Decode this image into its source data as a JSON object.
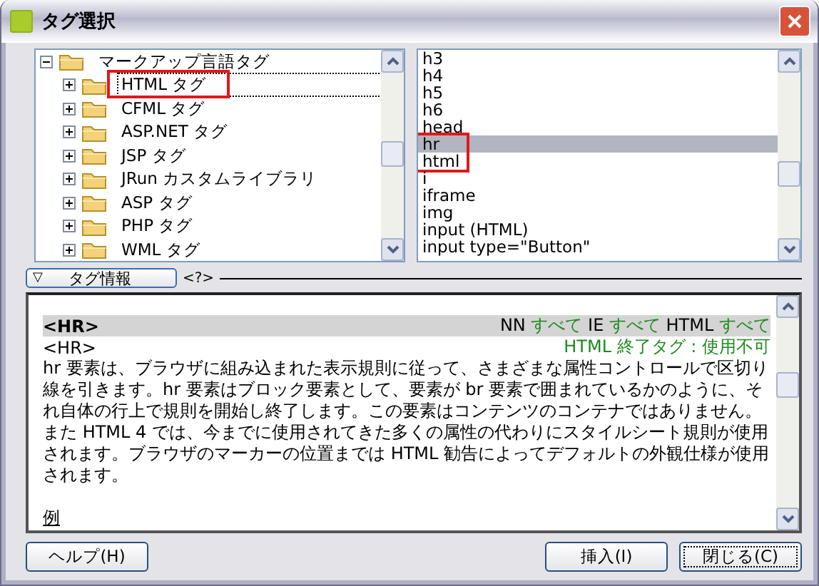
{
  "window": {
    "title": "タグ選択"
  },
  "tree": {
    "items": [
      {
        "label": "マークアップ言語タグ",
        "expanded": true,
        "focused": false,
        "highlighted": false,
        "children": [
          {
            "label": "HTML タグ",
            "expanded": false,
            "focused": true,
            "highlighted": true
          },
          {
            "label": "CFML タグ",
            "expanded": false,
            "focused": false,
            "highlighted": false
          },
          {
            "label": "ASP.NET タグ",
            "expanded": false,
            "focused": false,
            "highlighted": false
          },
          {
            "label": "JSP タグ",
            "expanded": false,
            "focused": false,
            "highlighted": false
          },
          {
            "label": "JRun カスタムライブラリ",
            "expanded": false,
            "focused": false,
            "highlighted": false
          },
          {
            "label": "ASP タグ",
            "expanded": false,
            "focused": false,
            "highlighted": false
          },
          {
            "label": "PHP タグ",
            "expanded": false,
            "focused": false,
            "highlighted": false
          },
          {
            "label": "WML タグ",
            "expanded": false,
            "focused": false,
            "highlighted": false
          }
        ]
      }
    ]
  },
  "tag_list": {
    "items": [
      {
        "label": "h3",
        "selected": false,
        "highlighted": false
      },
      {
        "label": "h4",
        "selected": false,
        "highlighted": false
      },
      {
        "label": "h5",
        "selected": false,
        "highlighted": false
      },
      {
        "label": "h6",
        "selected": false,
        "highlighted": false
      },
      {
        "label": "head",
        "selected": false,
        "highlighted": false
      },
      {
        "label": "hr",
        "selected": true,
        "highlighted": true
      },
      {
        "label": "html",
        "selected": false,
        "highlighted": true
      },
      {
        "label": "i",
        "selected": false,
        "highlighted": false
      },
      {
        "label": "iframe",
        "selected": false,
        "highlighted": false
      },
      {
        "label": "img",
        "selected": false,
        "highlighted": false
      },
      {
        "label": "input (HTML)",
        "selected": false,
        "highlighted": false
      },
      {
        "label": "input type=\"Button\"",
        "selected": false,
        "highlighted": false
      }
    ]
  },
  "section": {
    "toggle": "▽",
    "title": "タグ情報",
    "icon_text": "<?>"
  },
  "info": {
    "heading": "<HR>",
    "support": [
      {
        "label": "NN",
        "value": "すべて"
      },
      {
        "label": "IE",
        "value": "すべて"
      },
      {
        "label": "HTML",
        "value": "すべて"
      }
    ],
    "tag": "<HR>",
    "end_tag": "HTML 終了タグ : 使用不可",
    "description": "hr 要素は、ブラウザに組み込まれた表示規則に従って、さまざまな属性コントロールで区切り線を引きます。hr 要素はブロック要素として、要素が br 要素で囲まれているかのように、それ自体の行上で規則を開始し終了します。この要素はコンテンツのコンテナではありません。また HTML 4 では、今までに使用されてきた多くの属性の代わりにスタイルシート規則が使用されます。ブラウザのマーカーの位置までは HTML 勧告によってデフォルトの外観仕様が使用されます。",
    "example_link": "例"
  },
  "buttons": [
    {
      "label": "ヘルプ(H)",
      "kind": "help",
      "default": false
    },
    {
      "label": "挿入(I)",
      "kind": "insert",
      "default": false
    },
    {
      "label": "閉じる(C)",
      "kind": "close",
      "default": true
    }
  ]
}
